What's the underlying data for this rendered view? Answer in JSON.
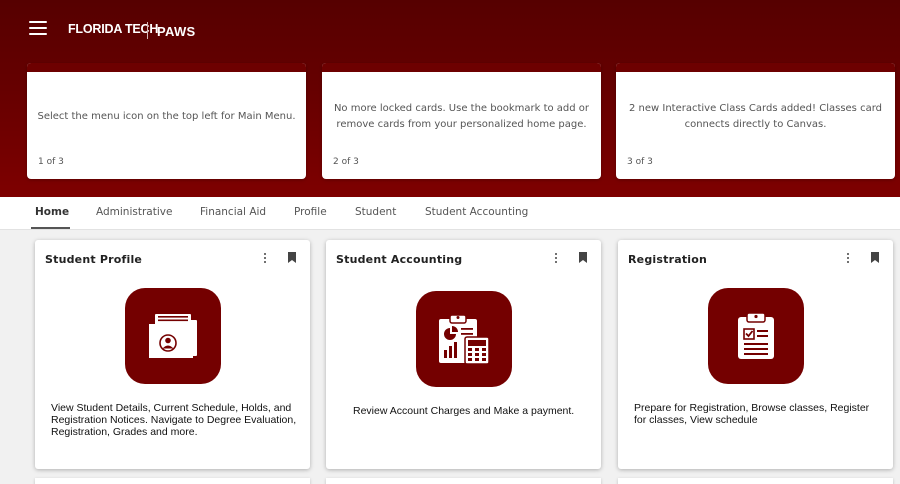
{
  "header": {
    "menu_icon": "hamburger-icon",
    "brand": "FLORIDA TECH",
    "app_name": "PAWS"
  },
  "notices": [
    {
      "text": "Select the menu icon on the top left for Main Menu.",
      "count": "1 of 3"
    },
    {
      "text": "No more locked cards. Use the bookmark to add or remove cards from your personalized home page.",
      "count": "2 of 3"
    },
    {
      "text": "2 new Interactive Class Cards added! Classes card connects directly to Canvas.",
      "count": "3 of 3"
    }
  ],
  "tabs": [
    {
      "label": "Home",
      "active": true
    },
    {
      "label": "Administrative"
    },
    {
      "label": "Financial Aid"
    },
    {
      "label": "Profile"
    },
    {
      "label": "Student"
    },
    {
      "label": "Student Accounting"
    }
  ],
  "cards": [
    {
      "title": "Student Profile",
      "icon": "student-folder-icon",
      "description": "View Student Details, Current Schedule, Holds, and Registration Notices. Navigate to Degree Evaluation, Registration, Grades and more."
    },
    {
      "title": "Student Accounting",
      "icon": "accounting-calculator-icon",
      "description": "Review Account Charges and Make a payment."
    },
    {
      "title": "Registration",
      "icon": "registration-clipboard-icon",
      "description": "Prepare for Registration, Browse classes, Register for classes, View schedule"
    }
  ],
  "colors": {
    "brand_dark": "#560000",
    "brand": "#740000",
    "accent_light": "#7e0000"
  }
}
